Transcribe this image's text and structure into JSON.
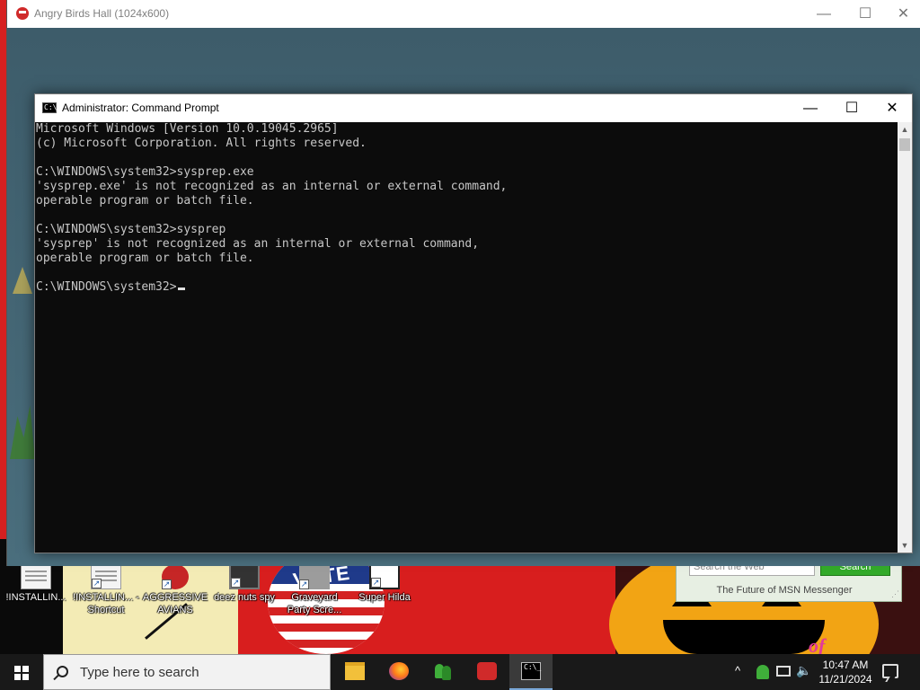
{
  "desktop": {
    "icons": [
      {
        "label": "!INSTALLIN...",
        "kind": "doc",
        "shortcut": false
      },
      {
        "label": "!INSTALLIN... - Shortcut",
        "kind": "doc",
        "shortcut": true
      },
      {
        "label": "AGGRESSIVE AVIANS",
        "kind": "bird",
        "shortcut": true
      },
      {
        "label": "deez nuts spy",
        "kind": "spy",
        "shortcut": true
      },
      {
        "label": "Graveyard Party Scre...",
        "kind": "grave",
        "shortcut": true
      },
      {
        "label": "Super Hilda",
        "kind": "hilda",
        "shortcut": true
      }
    ],
    "wallpaper_text": {
      "vote": "VOTE",
      "magenta": "of"
    }
  },
  "msn_widget": {
    "search_placeholder": "Search the Web",
    "search_button": "Search",
    "tagline": "The Future of MSN Messenger"
  },
  "game_window": {
    "title": "Angry Birds Hall (1024x600)",
    "minimize_glyph": "—",
    "maximize_glyph": "☐",
    "close_glyph": "✕"
  },
  "cmd_window": {
    "title": "Administrator: Command Prompt",
    "minimize_glyph": "—",
    "maximize_glyph": "☐",
    "close_glyph": "✕",
    "icon_text": "C:\\_",
    "lines": [
      "Microsoft Windows [Version 10.0.19045.2965]",
      "(c) Microsoft Corporation. All rights reserved.",
      "",
      "C:\\WINDOWS\\system32>sysprep.exe",
      "'sysprep.exe' is not recognized as an internal or external command,",
      "operable program or batch file.",
      "",
      "C:\\WINDOWS\\system32>sysprep",
      "'sysprep' is not recognized as an internal or external command,",
      "operable program or batch file.",
      "",
      "C:\\WINDOWS\\system32>"
    ],
    "scroll_up_glyph": "▲",
    "scroll_down_glyph": "▼"
  },
  "taskbar": {
    "search_placeholder": "Type here to search",
    "pinned": [
      {
        "name": "file-explorer-icon"
      },
      {
        "name": "firefox-icon"
      },
      {
        "name": "msn-messenger-icon"
      },
      {
        "name": "angry-birds-icon"
      },
      {
        "name": "command-prompt-icon",
        "active": true
      }
    ],
    "tray": {
      "chevron": "^",
      "volume_glyph": "🔈",
      "time": "10:47 AM",
      "date": "11/21/2024"
    }
  },
  "colors": {
    "cmd_background": "#0c0c0c",
    "cmd_text": "#c7c7c7",
    "taskbar": "#191919",
    "active_indicator": "#7aa8d8"
  }
}
